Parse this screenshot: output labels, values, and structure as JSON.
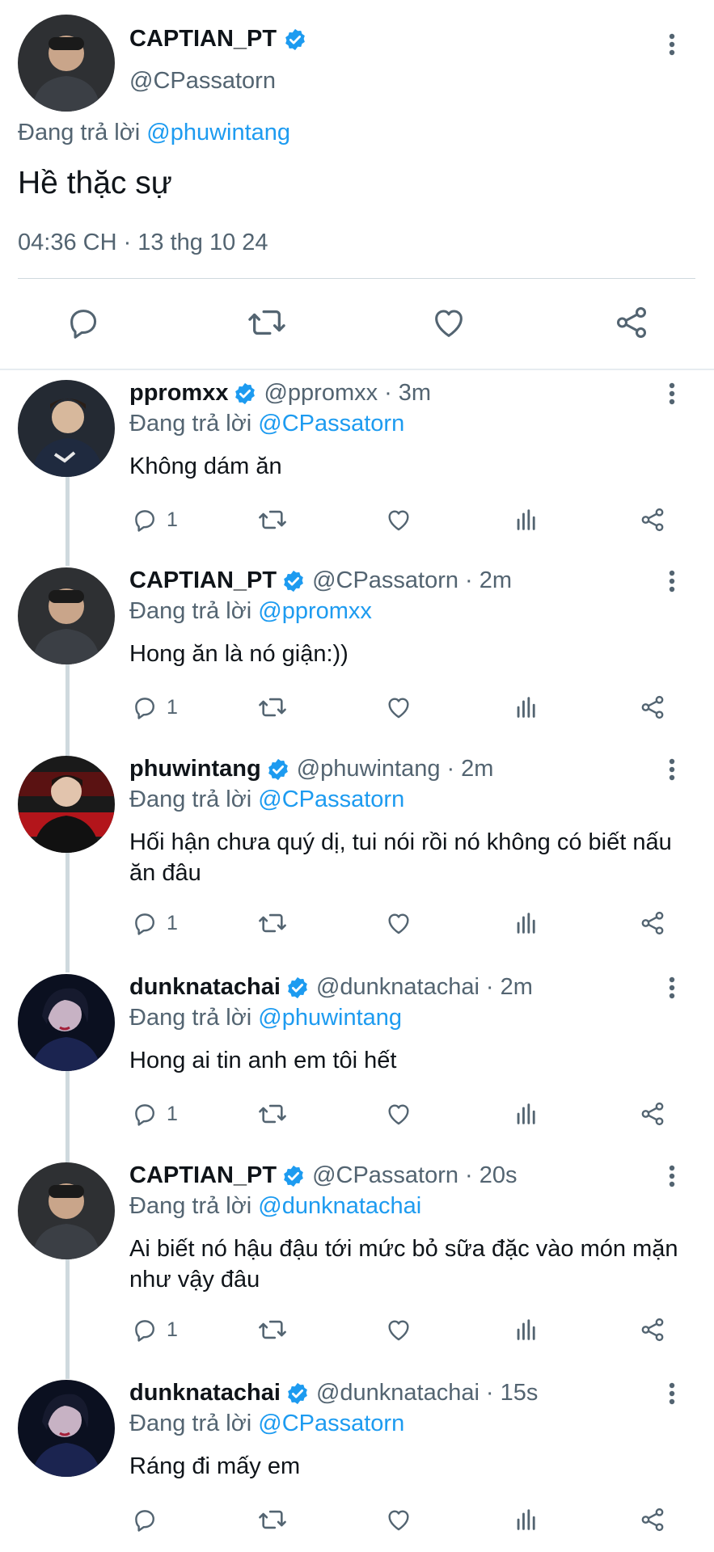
{
  "main_tweet": {
    "display_name": "CAPTIAN_PT",
    "handle": "@CPassatorn",
    "replying_prefix": "Đang trả lời",
    "replying_to": "@phuwintang",
    "text": "Hề thặc sự",
    "timestamp": "04:36 CH · 13 thg 10 24",
    "verified": true
  },
  "replies": [
    {
      "display_name": "ppromxx",
      "handle": "@ppromxx",
      "time": "3m",
      "replying_prefix": "Đang trả lời",
      "replying_to": "@CPassatorn",
      "text": "Không dám ăn",
      "reply_count": "1"
    },
    {
      "display_name": "CAPTIAN_PT",
      "handle": "@CPassatorn",
      "time": "2m",
      "replying_prefix": "Đang trả lời",
      "replying_to": "@ppromxx",
      "text": "Hong ăn là nó giận:))",
      "reply_count": "1"
    },
    {
      "display_name": "phuwintang",
      "handle": "@phuwintang",
      "time": "2m",
      "replying_prefix": "Đang trả lời",
      "replying_to": "@CPassatorn",
      "text": "Hối hận chưa quý dị, tui nói rồi nó không có biết nấu ăn đâu",
      "reply_count": "1"
    },
    {
      "display_name": "dunknatachai",
      "handle": "@dunknatachai",
      "time": "2m",
      "replying_prefix": "Đang trả lời",
      "replying_to": "@phuwintang",
      "text": "Hong ai tin anh em tôi hết",
      "reply_count": "1"
    },
    {
      "display_name": "CAPTIAN_PT",
      "handle": "@CPassatorn",
      "time": "20s",
      "replying_prefix": "Đang trả lời",
      "replying_to": "@dunknatachai",
      "text": "Ai biết nó hậu đậu tới mức bỏ sữa đặc vào món mặn như vậy đâu",
      "reply_count": "1"
    },
    {
      "display_name": "dunknatachai",
      "handle": "@dunknatachai",
      "time": "15s",
      "replying_prefix": "Đang trả lời",
      "replying_to": "@CPassatorn",
      "text": "Ráng đi mấy em",
      "reply_count": ""
    }
  ],
  "colors": {
    "accent": "#1d9bf0",
    "secondary_text": "#536471",
    "primary_text": "#0f1419",
    "divider": "#cfd9de"
  },
  "icons": [
    "verified-badge-icon",
    "more-vertical-icon",
    "reply-icon",
    "retweet-icon",
    "like-icon",
    "analytics-icon",
    "share-icon"
  ]
}
